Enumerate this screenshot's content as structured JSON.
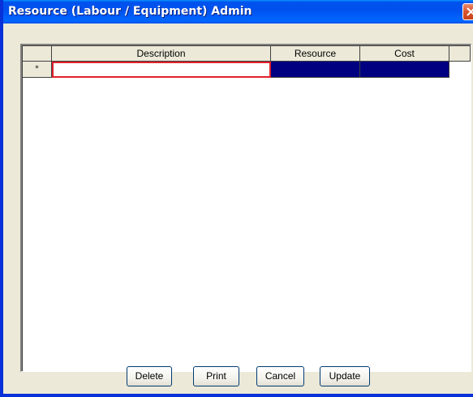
{
  "window": {
    "title": "Resource (Labour / Equipment) Admin"
  },
  "grid": {
    "columns": [
      "Description",
      "Resource",
      "Cost"
    ],
    "new_row_marker": "*",
    "rows": [
      {
        "description": "",
        "resource": "",
        "cost": ""
      }
    ]
  },
  "buttons": {
    "delete": "Delete",
    "print": "Print",
    "cancel": "Cancel",
    "update": "Update"
  },
  "colors": {
    "title_bar": "#0053ee",
    "selected_cell_border": "#e0212a",
    "selection_fill": "#000080",
    "client_bg": "#ece9d8"
  }
}
